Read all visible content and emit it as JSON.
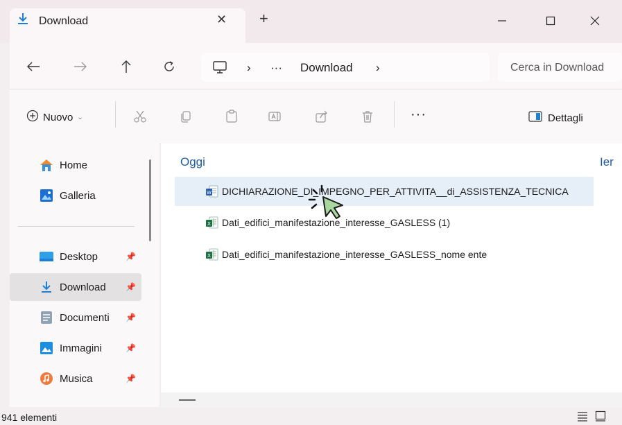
{
  "window": {
    "tab_title": "Download",
    "tab_close": "✕",
    "new_tab": "+",
    "minimize": "—",
    "maximize": "☐",
    "close": "✕"
  },
  "nav": {
    "breadcrumb_more": "···",
    "breadcrumb_current": "Download",
    "breadcrumb_arrow": "›",
    "search_placeholder": "Cerca in Download"
  },
  "toolbar": {
    "new_label": "Nuovo",
    "more": "···",
    "details_label": "Dettagli"
  },
  "sidebar": {
    "items": [
      {
        "label": "Home",
        "icon": "home-icon",
        "pinned": false
      },
      {
        "label": "Galleria",
        "icon": "gallery-icon",
        "pinned": false
      },
      {
        "label": "Desktop",
        "icon": "desktop-icon",
        "pinned": true
      },
      {
        "label": "Download",
        "icon": "download-icon",
        "pinned": true,
        "selected": true
      },
      {
        "label": "Documenti",
        "icon": "documents-icon",
        "pinned": true
      },
      {
        "label": "Immagini",
        "icon": "pictures-icon",
        "pinned": true
      },
      {
        "label": "Musica",
        "icon": "music-icon",
        "pinned": true
      }
    ]
  },
  "content": {
    "group_today": "Oggi",
    "group_yesterday": "Ier",
    "files": [
      {
        "name": "DICHIARAZIONE_DI_IMPEGNO_PER_ATTIVITA__di_ASSISTENZA_TECNICA",
        "type": "word"
      },
      {
        "name": "Dati_edifici_manifestazione_interesse_GASLESS (1)",
        "type": "excel"
      },
      {
        "name": "Dati_edifici_manifestazione_interesse_GASLESS_nome ente",
        "type": "excel"
      }
    ]
  },
  "status": {
    "count": "941 elementi"
  },
  "colors": {
    "accent": "#1f5da0",
    "selected_file": "#e6eef8",
    "cursor_fill": "#a8d8a0"
  }
}
